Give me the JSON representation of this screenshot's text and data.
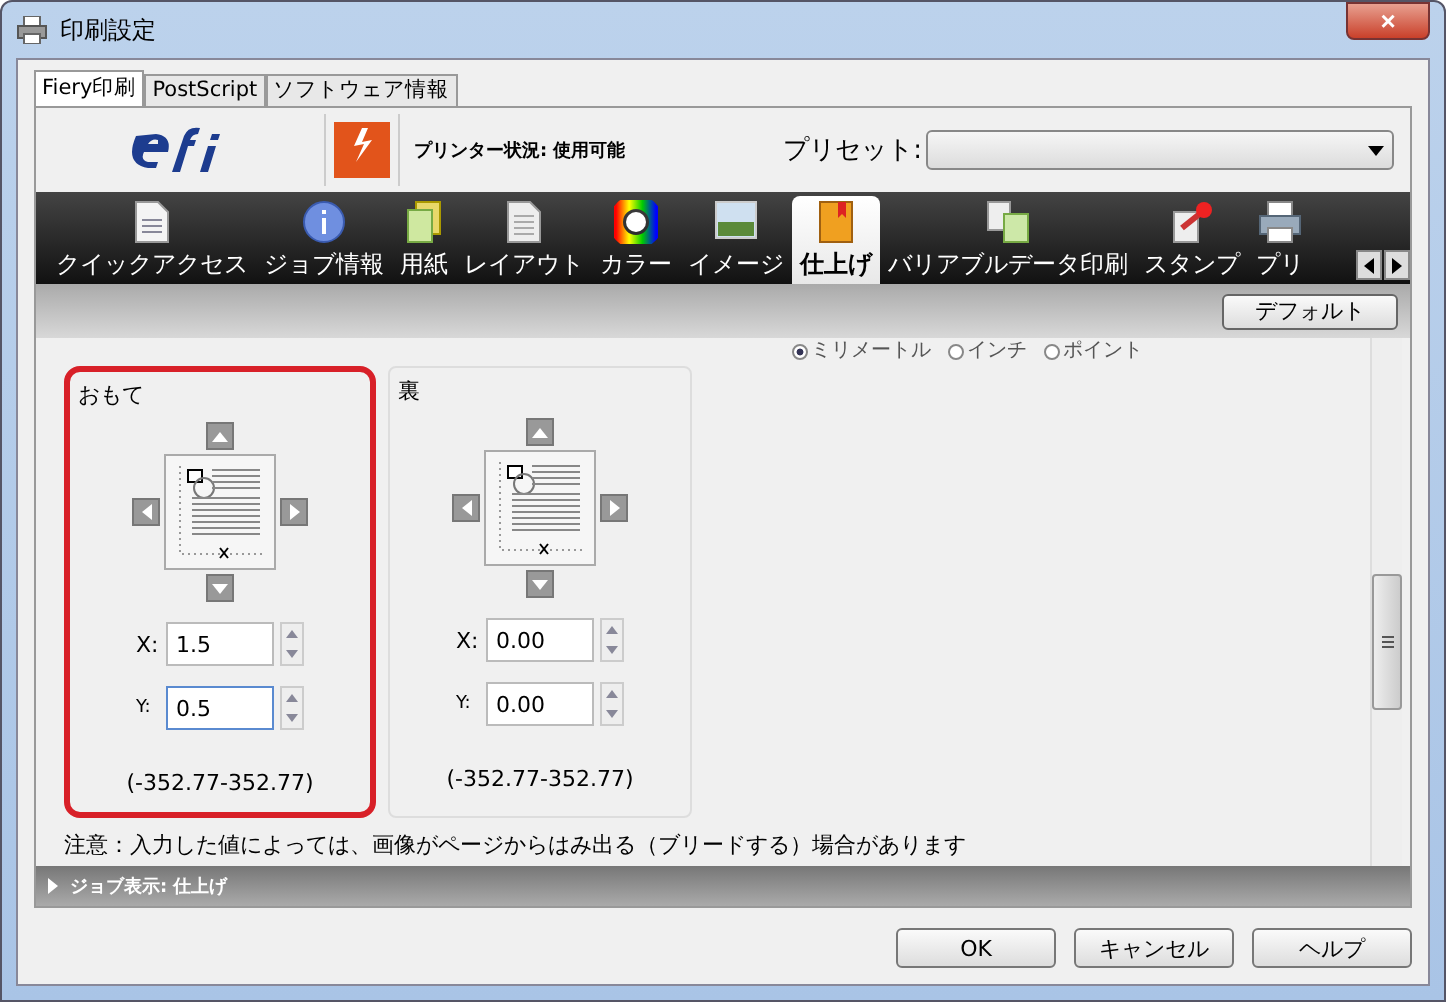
{
  "window": {
    "title": "印刷設定",
    "close": "×"
  },
  "tabs": [
    {
      "label": "Fiery印刷",
      "selected": true
    },
    {
      "label": "PostScript",
      "selected": false
    },
    {
      "label": "ソフトウェア情報",
      "selected": false
    }
  ],
  "header": {
    "status": "プリンター状況: 使用可能",
    "preset_label": "プリセット:"
  },
  "toolbar": {
    "items": [
      {
        "label": "クイックアクセス",
        "kind": "doc",
        "selected": false
      },
      {
        "label": "ジョブ情報",
        "kind": "info",
        "selected": false
      },
      {
        "label": "用紙",
        "kind": "paper",
        "selected": false
      },
      {
        "label": "レイアウト",
        "kind": "layout",
        "selected": false
      },
      {
        "label": "カラー",
        "kind": "color",
        "selected": false
      },
      {
        "label": "イメージ",
        "kind": "image",
        "selected": false
      },
      {
        "label": "仕上げ",
        "kind": "book",
        "selected": true
      },
      {
        "label": "バリアブルデータ印刷",
        "kind": "variable",
        "selected": false
      },
      {
        "label": "スタンプ",
        "kind": "stamp",
        "selected": false
      },
      {
        "label": "プリ",
        "kind": "printer",
        "selected": false
      }
    ]
  },
  "default_button": "デフォルト",
  "units": [
    {
      "label": "ミリメートル",
      "selected": true
    },
    {
      "label": "インチ",
      "selected": false
    },
    {
      "label": "ポイント",
      "selected": false
    }
  ],
  "sides": [
    {
      "title": "おもて",
      "highlighted": true,
      "x_label": "X:",
      "x_value": "1.5",
      "y_label": "Y:",
      "y_value": "0.5",
      "y_focused": true,
      "range": "(-352.77-352.77)"
    },
    {
      "title": "裏",
      "highlighted": false,
      "x_label": "X:",
      "x_value": "0.00",
      "y_label": "Y:",
      "y_value": "0.00",
      "y_focused": false,
      "range": "(-352.77-352.77)"
    }
  ],
  "note": "注意：入力した値によっては、画像がページからはみ出る（ブリードする）場合があります",
  "job_bar": "ジョブ表示: 仕上げ",
  "buttons": [
    "OK",
    "キャンセル",
    "ヘルプ"
  ]
}
